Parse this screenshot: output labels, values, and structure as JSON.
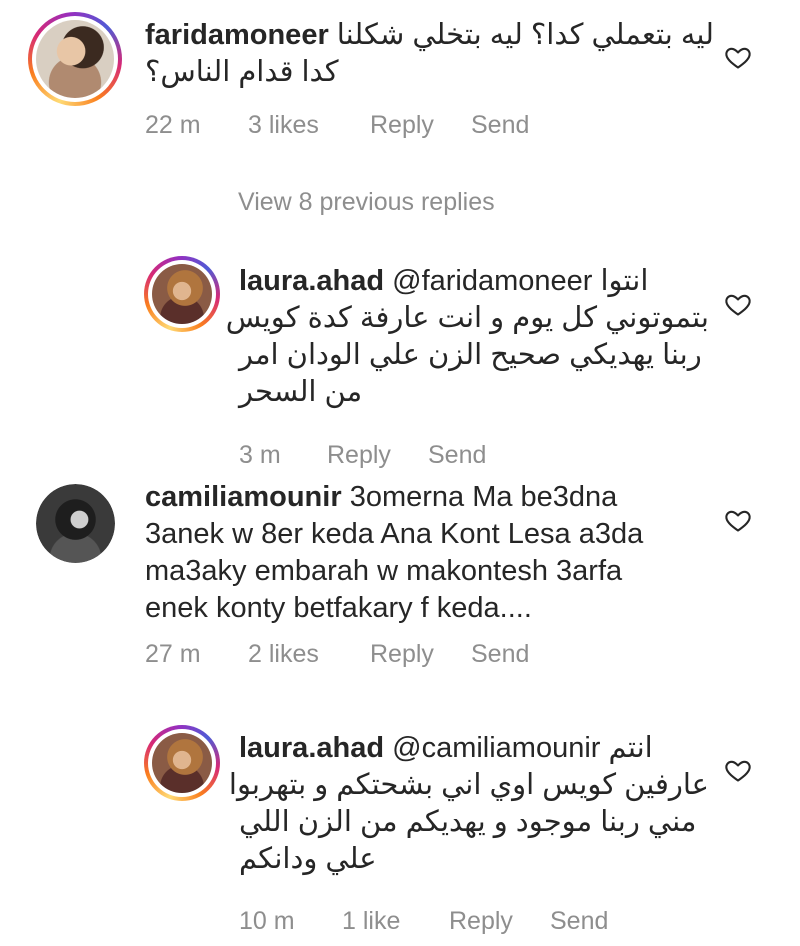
{
  "comments": [
    {
      "username": "faridamoneer",
      "mention": "",
      "lines": [
        "ليه بتعملي كدا؟ ليه بتخلي شكلنا",
        "كدا قدام الناس؟"
      ],
      "time": "22 m",
      "likes": "3 likes",
      "reply_label": "Reply",
      "send_label": "Send"
    },
    {
      "username": "laura.ahad",
      "mention": "@faridamoneer",
      "lines": [
        "انتوا",
        "بتموتوني كل يوم و انت عارفة كدة كويس",
        "ربنا يهديكي صحيح الزن علي الودان امر",
        "من السحر"
      ],
      "time": "3 m",
      "likes": "",
      "reply_label": "Reply",
      "send_label": "Send"
    },
    {
      "username": "camiliamounir",
      "mention": "",
      "lines": [
        "3omerna Ma be3dna",
        "3anek w 8er keda Ana Kont Lesa a3da",
        "ma3aky embarah w makontesh 3arfa",
        "enek konty betfakary f keda...."
      ],
      "time": "27 m",
      "likes": "2 likes",
      "reply_label": "Reply",
      "send_label": "Send"
    },
    {
      "username": "laura.ahad",
      "mention": "@camiliamounir",
      "lines": [
        "انتم",
        "عارفين كويس اوي اني بشحتكم و بتهربوا",
        "مني ربنا موجود و يهديكم من الزن اللي",
        "علي ودانكم"
      ],
      "time": "10 m",
      "likes": "1 like",
      "reply_label": "Reply",
      "send_label": "Send"
    }
  ],
  "view_replies": "View 8 previous replies",
  "icons": {
    "like": "heart-outline-icon"
  },
  "colors": {
    "text": "#262626",
    "meta": "#8e8e8e",
    "story_ring_start": "#feda75",
    "story_ring_end": "#d62976"
  }
}
